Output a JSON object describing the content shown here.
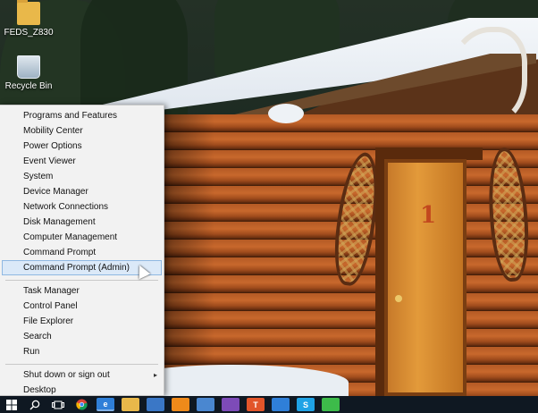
{
  "desktop": {
    "icons": [
      {
        "label": "FEDS_Z830",
        "icon": "folder-icon"
      },
      {
        "label": "Recycle Bin",
        "icon": "recycle-bin-icon"
      }
    ],
    "wallpaper": {
      "door_number": "1"
    }
  },
  "winx_menu": {
    "groups": [
      [
        {
          "label": "Programs and Features"
        },
        {
          "label": "Mobility Center"
        },
        {
          "label": "Power Options"
        },
        {
          "label": "Event Viewer"
        },
        {
          "label": "System"
        },
        {
          "label": "Device Manager"
        },
        {
          "label": "Network Connections"
        },
        {
          "label": "Disk Management"
        },
        {
          "label": "Computer Management"
        },
        {
          "label": "Command Prompt"
        },
        {
          "label": "Command Prompt (Admin)",
          "selected": true
        }
      ],
      [
        {
          "label": "Task Manager"
        },
        {
          "label": "Control Panel"
        },
        {
          "label": "File Explorer"
        },
        {
          "label": "Search"
        },
        {
          "label": "Run"
        }
      ],
      [
        {
          "label": "Shut down or sign out",
          "has_submenu": true
        },
        {
          "label": "Desktop"
        }
      ]
    ],
    "submenu_arrow": "▸"
  },
  "taskbar": {
    "items": [
      {
        "icon": "windows-start-icon"
      },
      {
        "icon": "search-icon"
      },
      {
        "icon": "task-view-icon"
      },
      {
        "icon": "chrome-icon"
      },
      {
        "icon": "edge-icon",
        "letter": "e",
        "color": "#2f7fd8"
      },
      {
        "icon": "file-explorer-icon",
        "color": "#e9b84a"
      },
      {
        "icon": "store-icon",
        "color": "#3a77c6"
      },
      {
        "icon": "media-player-icon",
        "color": "#ef8a1a"
      },
      {
        "icon": "photos-icon",
        "color": "#4a87d0"
      },
      {
        "icon": "viber-icon",
        "color": "#7d4bb8"
      },
      {
        "icon": "app-t-icon",
        "letter": "T",
        "color": "#e2552a"
      },
      {
        "icon": "paint-icon",
        "color": "#2f7fd8"
      },
      {
        "icon": "skype-icon",
        "letter": "S",
        "color": "#1fa3e6"
      },
      {
        "icon": "messages-icon",
        "color": "#3dbb4a"
      }
    ]
  }
}
